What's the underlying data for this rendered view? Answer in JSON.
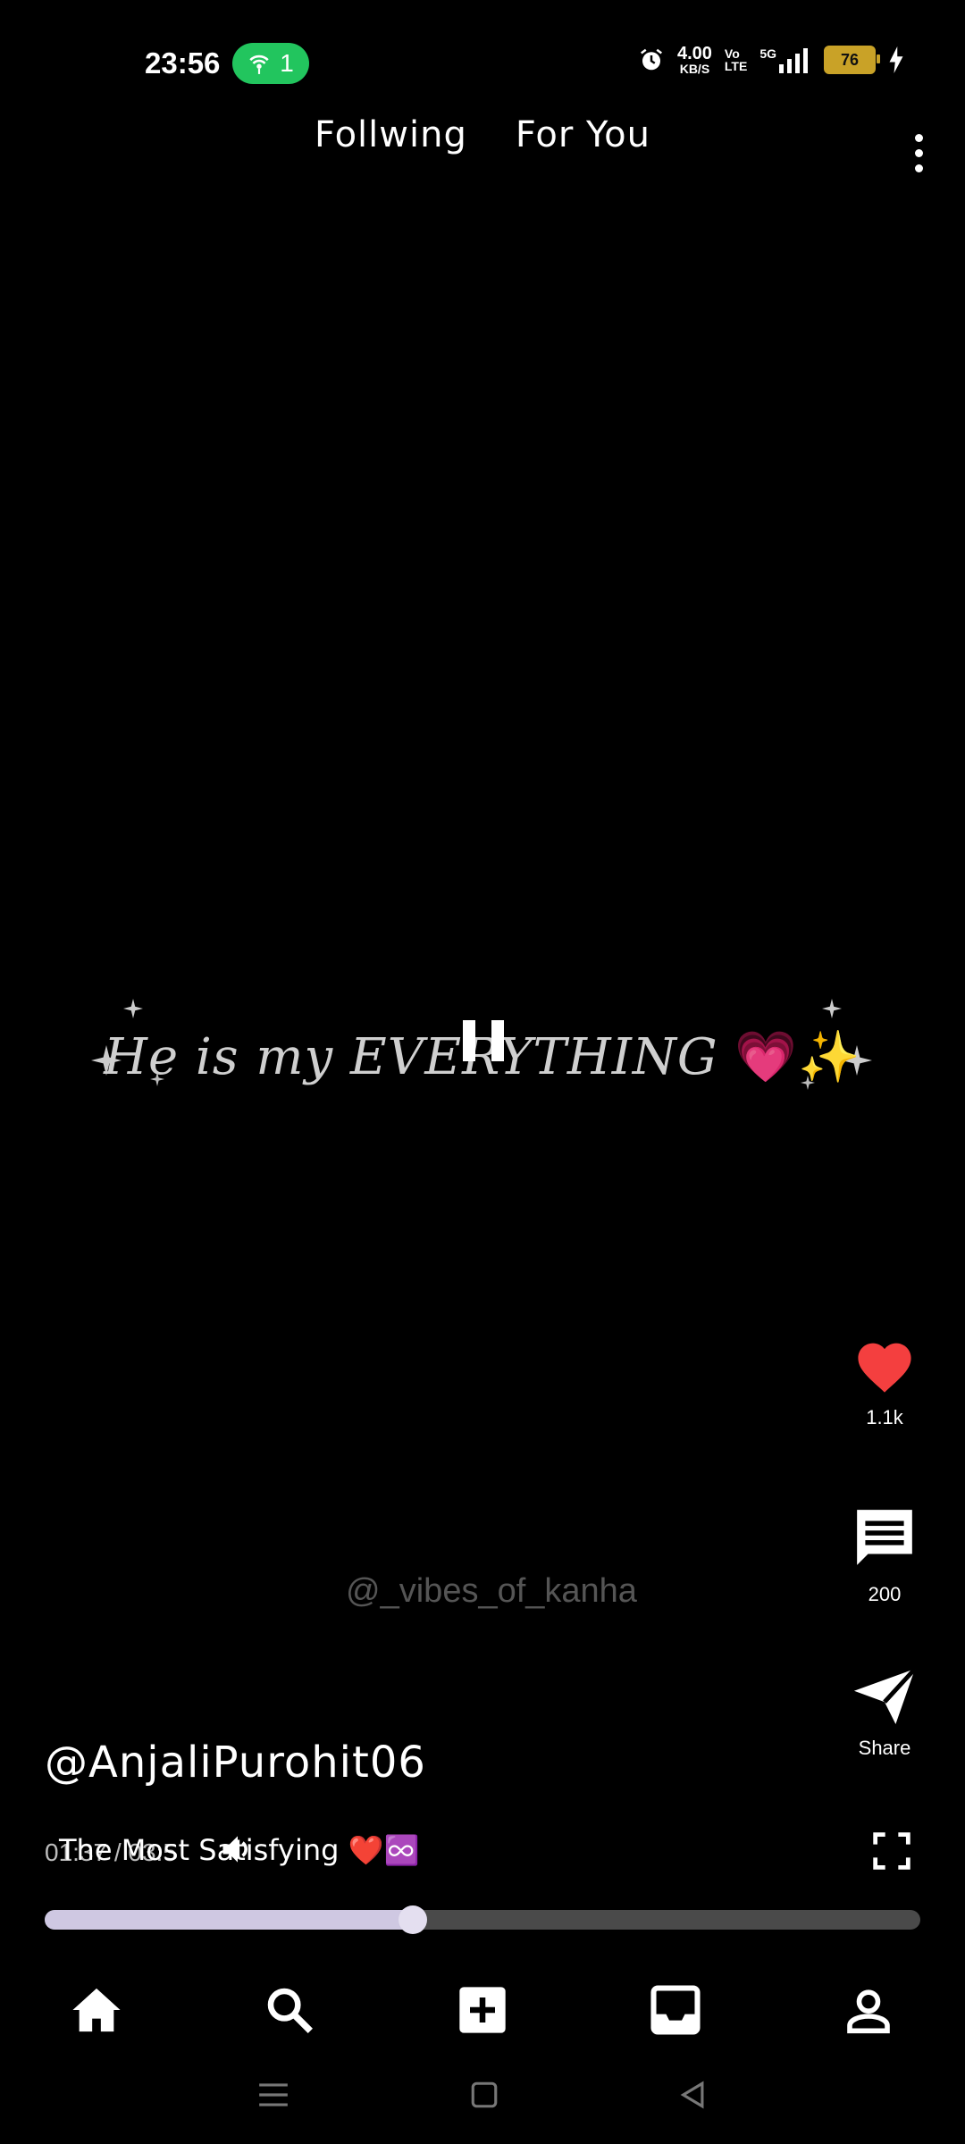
{
  "status_bar": {
    "time": "23:56",
    "hotspot_count": "1",
    "net_speed_value": "4.00",
    "net_speed_unit": "KB/S",
    "volte_top": "Vo",
    "volte_bottom": "LTE",
    "network": "5G",
    "battery": "76"
  },
  "tabs": {
    "following": "Follwing",
    "for_you": "For You"
  },
  "video": {
    "overlay_text": "He is my EVERYTHING",
    "overlay_emojis": "💗✨",
    "watermark": "@_vibes_of_kanha"
  },
  "actions": {
    "likes": "1.1k",
    "comments": "200",
    "share": "Share"
  },
  "post": {
    "username": "@AnjaliPurohit06",
    "caption": "The Most Satisfying",
    "caption_emojis": "❤️♾️",
    "time_display": "01:37 / 03:5",
    "progress": 0.42
  },
  "icons": {
    "like": "heart-icon",
    "comment": "comment-icon",
    "share": "send-icon",
    "more": "more-vertical-icon",
    "volume": "volume-icon",
    "fullscreen": "fullscreen-icon",
    "pause": "pause-icon"
  },
  "nav": {
    "items": [
      "home-icon",
      "search-icon",
      "add-icon",
      "inbox-icon",
      "profile-icon"
    ]
  },
  "colors": {
    "like": "#f43f3f",
    "hotspot": "#22c55e",
    "battery": "#c9a227",
    "progress_fill": "#cfc8e2",
    "progress_track": "#4a4a4a"
  }
}
